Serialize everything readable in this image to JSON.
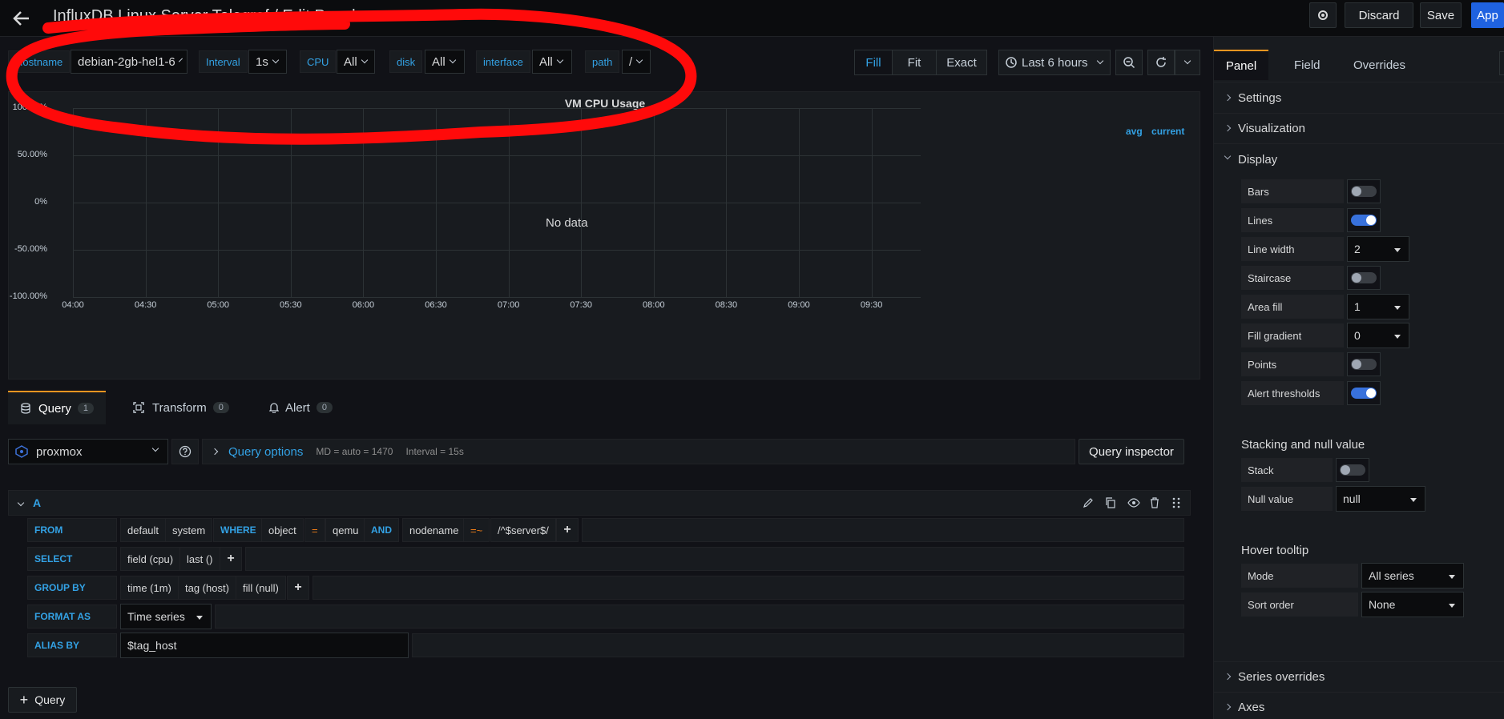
{
  "header": {
    "title": "InfluxDB Linux Server Telegraf / Edit Panel",
    "discard": "Discard",
    "save": "Save",
    "apply": "App"
  },
  "variables": [
    {
      "label": "Hostname",
      "value": "debian-2gb-hel1-6"
    },
    {
      "label": "Interval",
      "value": "1s"
    },
    {
      "label": "CPU",
      "value": "All"
    },
    {
      "label": "disk",
      "value": "All"
    },
    {
      "label": "interface",
      "value": "All"
    },
    {
      "label": "path",
      "value": "/"
    }
  ],
  "view_modes": [
    "Fill",
    "Fit",
    "Exact"
  ],
  "time_range": "Last 6 hours",
  "panel": {
    "title": "VM CPU Usage",
    "no_data": "No data",
    "legend": [
      "avg",
      "current"
    ]
  },
  "chart_data": {
    "type": "line",
    "title": "VM CPU Usage",
    "x": [
      "04:00",
      "04:30",
      "05:00",
      "05:30",
      "06:00",
      "06:30",
      "07:00",
      "07:30",
      "08:00",
      "08:30",
      "09:00",
      "09:30"
    ],
    "y_ticks": [
      "100.00%",
      "50.00%",
      "0%",
      "-50.00%",
      "-100.00%"
    ],
    "ylim": [
      -100,
      100
    ],
    "series": [],
    "legend": [
      "avg",
      "current"
    ],
    "annotation": "No data"
  },
  "tabs": [
    {
      "label": "Query",
      "count": "1"
    },
    {
      "label": "Transform",
      "count": "0"
    },
    {
      "label": "Alert",
      "count": "0"
    }
  ],
  "query": {
    "datasource": "proxmox",
    "options_label": "Query options",
    "md": "MD = auto = 1470",
    "interval": "Interval = 15s",
    "inspector": "Query inspector",
    "ref": "A",
    "from_label": "FROM",
    "from": [
      "default",
      "system"
    ],
    "where_label": "WHERE",
    "where": {
      "k1": "object",
      "op1": "=",
      "v1": "qemu",
      "and": "AND",
      "k2": "nodename",
      "op2": "=~",
      "v2": "/^$server$/"
    },
    "select_label": "SELECT",
    "select": [
      "field (cpu)",
      "last ()"
    ],
    "groupby_label": "GROUP BY",
    "groupby": [
      "time (1m)",
      "tag (host)",
      "fill (null)"
    ],
    "format_label": "FORMAT AS",
    "format": "Time series",
    "alias_label": "ALIAS BY",
    "alias": "$tag_host",
    "add_query": "Query"
  },
  "options": {
    "tabs": [
      "Panel",
      "Field",
      "Overrides"
    ],
    "sections": {
      "settings": "Settings",
      "visualization": "Visualization",
      "display": "Display",
      "series_overrides": "Series overrides",
      "axes": "Axes"
    },
    "display": {
      "bars": {
        "label": "Bars",
        "on": false
      },
      "lines": {
        "label": "Lines",
        "on": true
      },
      "line_width": {
        "label": "Line width",
        "value": "2"
      },
      "staircase": {
        "label": "Staircase",
        "on": false
      },
      "area_fill": {
        "label": "Area fill",
        "value": "1"
      },
      "fill_gradient": {
        "label": "Fill gradient",
        "value": "0"
      },
      "points": {
        "label": "Points",
        "on": false
      },
      "alert_thresholds": {
        "label": "Alert thresholds",
        "on": true
      }
    },
    "stacking": {
      "title": "Stacking and null value",
      "stack": "Stack",
      "null_value_label": "Null value",
      "null_value": "null"
    },
    "hover": {
      "title": "Hover tooltip",
      "mode_label": "Mode",
      "mode": "All series",
      "sort_label": "Sort order",
      "sort": "None"
    }
  }
}
